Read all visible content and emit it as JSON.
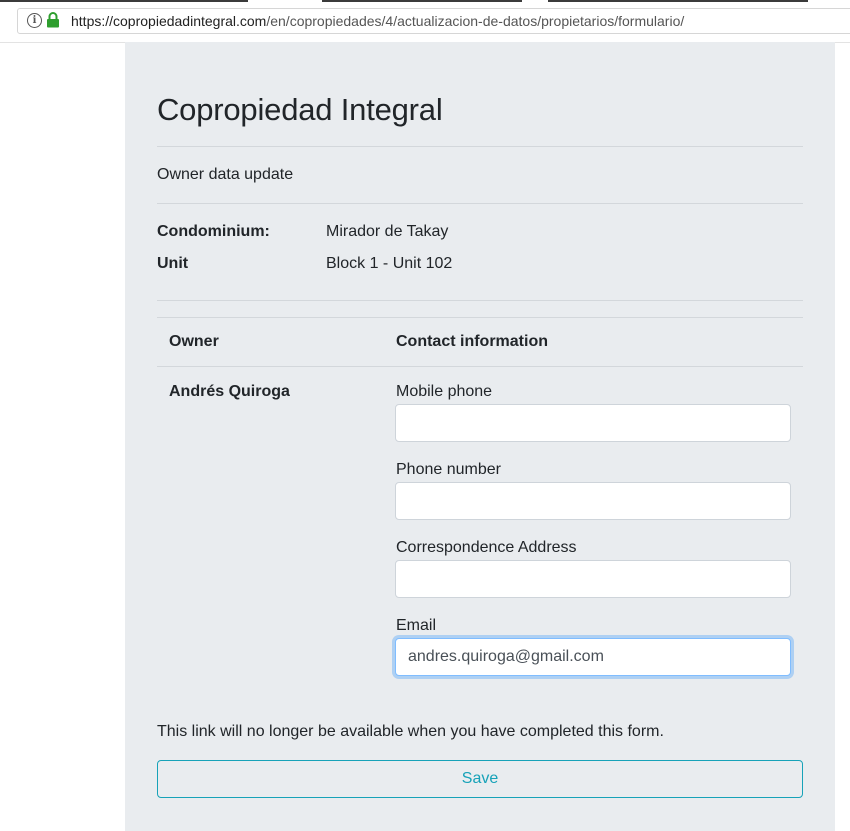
{
  "browser": {
    "url_host": "https://copropiedadintegral.com",
    "url_path": "/en/copropiedades/4/actualizacion-de-datos/propietarios/formulario/"
  },
  "page": {
    "title": "Copropiedad Integral",
    "subtitle": "Owner data update",
    "condominium_label": "Condominium:",
    "condominium_value": "Mirador de Takay",
    "unit_label": "Unit",
    "unit_value": "Block 1 - Unit 102"
  },
  "table": {
    "headers": [
      "Owner",
      "Contact information"
    ],
    "owner_name": "Andrés Quiroga"
  },
  "form": {
    "mobile_label": "Mobile phone",
    "mobile_value": "",
    "phone_label": "Phone number",
    "phone_value": "",
    "address_label": "Correspondence Address",
    "address_value": "",
    "email_label": "Email",
    "email_value": "andres.quiroga@gmail.com"
  },
  "footer": {
    "note": "This link will no longer be available when you have completed this form.",
    "save_label": "Save"
  },
  "colors": {
    "panel_bg": "#e9ecef",
    "accent": "#17a2b8",
    "focus": "#80bdff",
    "lock": "#2e9e2e"
  }
}
